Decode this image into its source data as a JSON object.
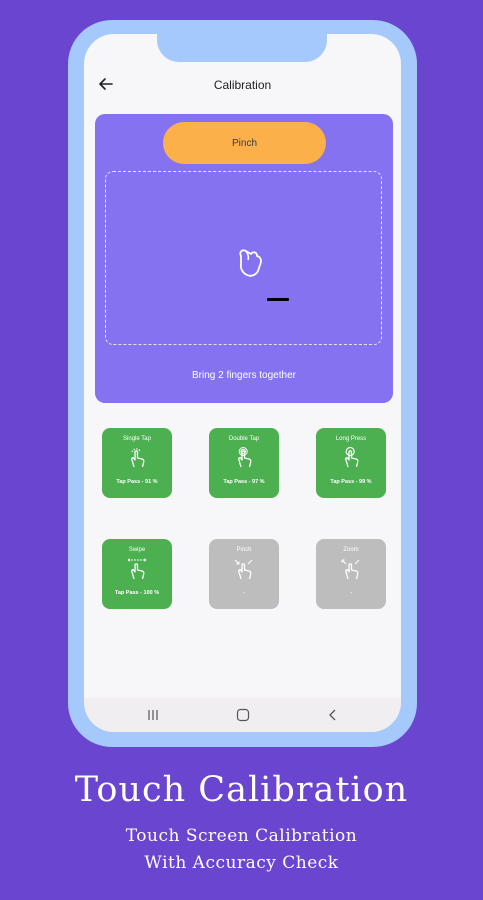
{
  "header": {
    "title": "Calibration"
  },
  "panel": {
    "pinch_button": "Pinch",
    "instruction": "Bring 2 fingers together"
  },
  "tests": [
    {
      "name": "Single Tap",
      "result": "Tap Pass - 91 %",
      "status": "passed",
      "icon": "single-tap-icon"
    },
    {
      "name": "Double Tap",
      "result": "Tap Pass - 97 %",
      "status": "passed",
      "icon": "double-tap-icon"
    },
    {
      "name": "Long Press",
      "result": "Tap Pass - 99 %",
      "status": "passed",
      "icon": "long-press-icon"
    },
    {
      "name": "Swipe",
      "result": "Tap Pass - 100 %",
      "status": "passed",
      "icon": "swipe-icon"
    },
    {
      "name": "Pinch",
      "result": "-",
      "status": "pending",
      "icon": "pinch-icon"
    },
    {
      "name": "Zoom",
      "result": "-",
      "status": "pending",
      "icon": "zoom-icon"
    }
  ],
  "promo": {
    "headline": "Touch Calibration",
    "line1": "Touch Screen Calibration",
    "line2": "With Accuracy Check"
  },
  "colors": {
    "background": "#6a45cf",
    "panel": "#8572f0",
    "accent_button": "#fbb04a",
    "passed": "#4caf50",
    "pending": "#bdbdbd"
  }
}
